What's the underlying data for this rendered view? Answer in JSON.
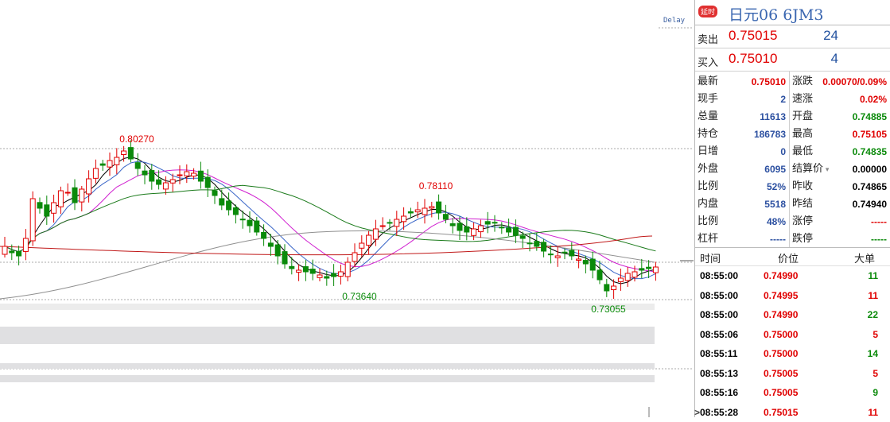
{
  "chart": {
    "delay_label": "Delay",
    "annotations": {
      "high1": "0.80270",
      "high2": "0.78110",
      "low1": "0.73640",
      "low2": "0.73055"
    },
    "colors": {
      "up": "#e00000",
      "down": "#0a8a0a",
      "ma5": "#000000",
      "ma10": "#3a66c8",
      "ma20": "#d020d0",
      "ma60": "#1a7a1a",
      "ma120": "#909090",
      "ma250": "#c01818"
    }
  },
  "panel": {
    "badge": "延时",
    "title": "日元06  6JM3",
    "ask": {
      "label": "卖出",
      "price": "0.75015",
      "vol": "24"
    },
    "bid": {
      "label": "买入",
      "price": "0.75010",
      "vol": "4"
    },
    "stats": [
      {
        "k": "最新",
        "v": "0.75010",
        "c": "red"
      },
      {
        "k": "涨跌",
        "v": "0.00070/0.09%",
        "c": "red"
      },
      {
        "k": "现手",
        "v": "2",
        "c": "blue"
      },
      {
        "k": "速涨",
        "v": "0.02%",
        "c": "red"
      },
      {
        "k": "总量",
        "v": "11613",
        "c": "blue"
      },
      {
        "k": "开盘",
        "v": "0.74885",
        "c": "green"
      },
      {
        "k": "持仓",
        "v": "186783",
        "c": "blue"
      },
      {
        "k": "最高",
        "v": "0.75105",
        "c": "red"
      },
      {
        "k": "日增",
        "v": "0",
        "c": "blue"
      },
      {
        "k": "最低",
        "v": "0.74835",
        "c": "green"
      },
      {
        "k": "外盘",
        "v": "6095",
        "c": "blue"
      },
      {
        "k": "结算价",
        "v": "0.00000",
        "c": "blk"
      },
      {
        "k": "比例",
        "v": "52%",
        "c": "blue"
      },
      {
        "k": "昨收",
        "v": "0.74865",
        "c": "blk"
      },
      {
        "k": "内盘",
        "v": "5518",
        "c": "blue"
      },
      {
        "k": "昨结",
        "v": "0.74940",
        "c": "blk"
      },
      {
        "k": "比例",
        "v": "48%",
        "c": "blue"
      },
      {
        "k": "涨停",
        "v": "-----",
        "c": "red"
      },
      {
        "k": "杠杆",
        "v": "-----",
        "c": "blue"
      },
      {
        "k": "跌停",
        "v": "-----",
        "c": "green"
      }
    ],
    "trades_header": {
      "time": "时间",
      "price": "价位",
      "vol": "大单"
    },
    "trades": [
      {
        "time": "08:55:00",
        "price": "0.74990",
        "vol": "11",
        "vc": "green"
      },
      {
        "time": "08:55:00",
        "price": "0.74995",
        "vol": "11",
        "vc": "red"
      },
      {
        "time": "08:55:00",
        "price": "0.74990",
        "vol": "22",
        "vc": "green"
      },
      {
        "time": "08:55:06",
        "price": "0.75000",
        "vol": "5",
        "vc": "red"
      },
      {
        "time": "08:55:11",
        "price": "0.75000",
        "vol": "14",
        "vc": "green"
      },
      {
        "time": "08:55:13",
        "price": "0.75005",
        "vol": "5",
        "vc": "red"
      },
      {
        "time": "08:55:16",
        "price": "0.75005",
        "vol": "9",
        "vc": "green"
      },
      {
        "time": "08:55:28",
        "price": "0.75015",
        "vol": "11",
        "vc": "red"
      }
    ]
  }
}
